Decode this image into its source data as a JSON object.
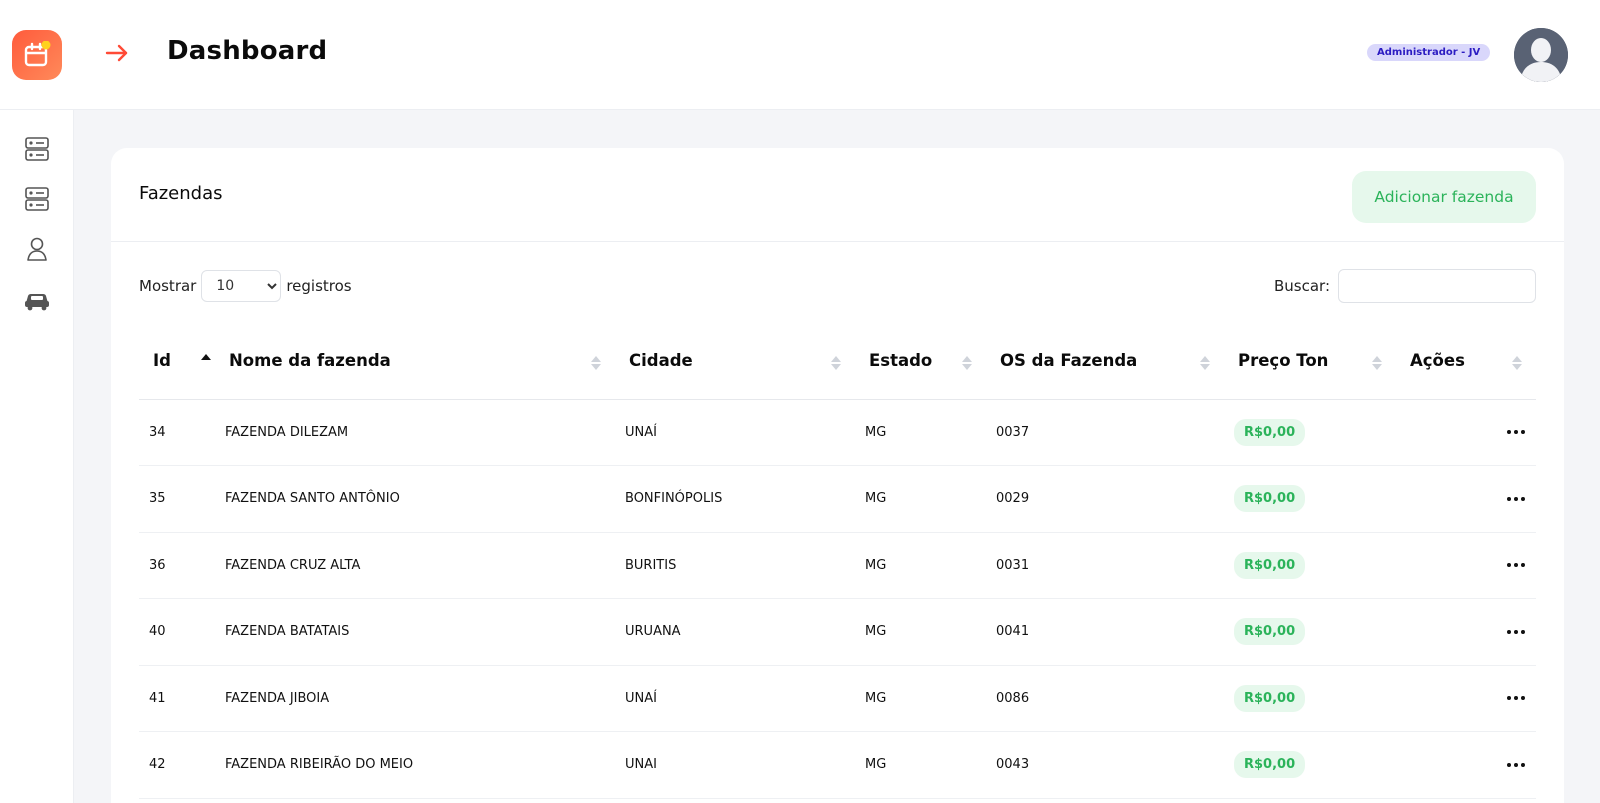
{
  "header": {
    "title": "Dashboard",
    "role_badge": "Administrador - JV",
    "logo_icon": "calendar-app-logo-icon",
    "back_icon": "arrow-right-icon",
    "avatar_icon": "user-silhouette-icon"
  },
  "sidebar": {
    "items": [
      {
        "icon": "server-database-icon"
      },
      {
        "icon": "server-database-icon"
      },
      {
        "icon": "user-icon"
      },
      {
        "icon": "car-icon"
      }
    ]
  },
  "card": {
    "title": "Fazendas",
    "add_button": "Adicionar fazenda"
  },
  "controls": {
    "show_label": "Mostrar",
    "page_size": "10",
    "records_label": "registros",
    "search_label": "Buscar:",
    "search_value": ""
  },
  "table": {
    "columns": [
      "Id",
      "Nome da fazenda",
      "Cidade",
      "Estado",
      "OS da Fazenda",
      "Preço Ton",
      "Ações"
    ],
    "sorted_column": "Id",
    "sort_direction": "ascending",
    "rows": [
      {
        "id": "34",
        "name": "FAZENDA DILEZAM",
        "city": "UNAÍ",
        "state": "MG",
        "os": "0037",
        "price": "R$0,00"
      },
      {
        "id": "35",
        "name": "FAZENDA SANTO ANTÔNIO",
        "city": "BONFINÓPOLIS",
        "state": "MG",
        "os": "0029",
        "price": "R$0,00"
      },
      {
        "id": "36",
        "name": "FAZENDA CRUZ ALTA",
        "city": "BURITIS",
        "state": "MG",
        "os": "0031",
        "price": "R$0,00"
      },
      {
        "id": "40",
        "name": "FAZENDA BATATAIS",
        "city": "URUANA",
        "state": "MG",
        "os": "0041",
        "price": "R$0,00"
      },
      {
        "id": "41",
        "name": "FAZENDA JIBOIA",
        "city": "UNAÍ",
        "state": "MG",
        "os": "0086",
        "price": "R$0,00"
      },
      {
        "id": "42",
        "name": "FAZENDA RIBEIRÃO DO MEIO",
        "city": "UNAI",
        "state": "MG",
        "os": "0043",
        "price": "R$0,00"
      }
    ]
  },
  "colors": {
    "accent": "#ff5b3c",
    "success": "#2bb35a",
    "success_bg": "#e6f8ec",
    "badge_bg": "#d9d7fb",
    "badge_text": "#2c1cc2"
  }
}
